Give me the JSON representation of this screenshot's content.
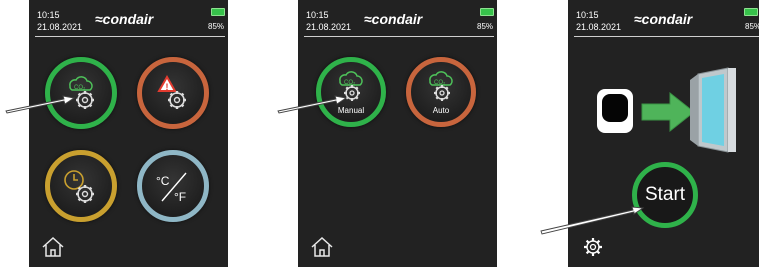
{
  "status": {
    "time": "10:15",
    "date": "21.08.2021",
    "battery": "85%",
    "brand": "≈condair"
  },
  "screen1": {
    "buttons": [
      "co2-gear",
      "warning-gear",
      "clock-gear",
      "temperature-unit"
    ],
    "temp_c": "°C",
    "temp_f": "°F",
    "co2": "CO₂"
  },
  "screen2": {
    "manual_label": "Manual",
    "auto_label": "Auto",
    "co2": "CO₂"
  },
  "screen3": {
    "start_label": "Start"
  },
  "colors": {
    "green": "#2fb24a",
    "orange": "#c8653d",
    "yellow": "#c9a02f",
    "blue": "#8fb7c6",
    "background": "#222222"
  },
  "icons": [
    "home-icon",
    "settings-icon",
    "sensor-icon",
    "window-icon",
    "arrow-icon"
  ]
}
